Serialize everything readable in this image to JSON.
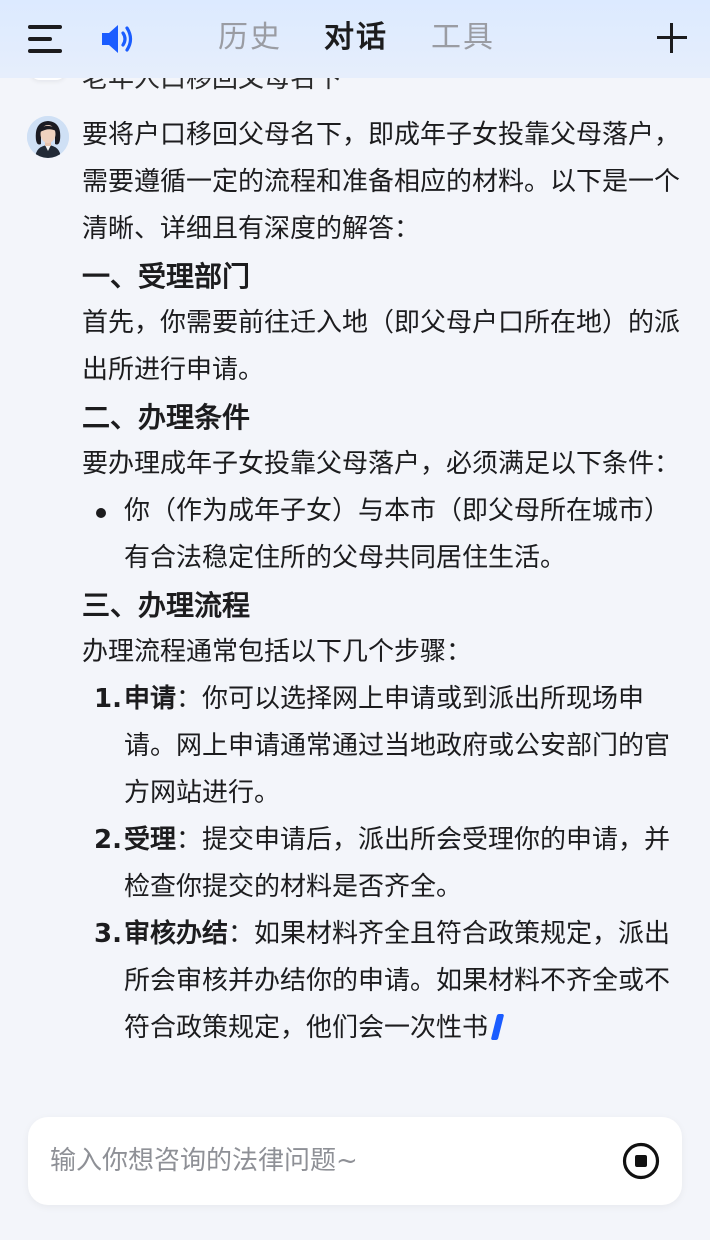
{
  "nav": {
    "tabs": [
      {
        "label": "历史",
        "active": false
      },
      {
        "label": "对话",
        "active": true
      },
      {
        "label": "工具",
        "active": false
      }
    ],
    "icons": [
      "menu-icon",
      "speaker-icon",
      "plus-icon"
    ],
    "accent_color": "#1a5cff"
  },
  "previous_message_cut": "老年人口移回父母名下",
  "answer": {
    "intro": "要将户口移回父母名下，即成年子女投靠父母落户，需要遵循一定的流程和准备相应的材料。以下是一个清晰、详细且有深度的解答：",
    "sections": [
      {
        "heading": "一、受理部门",
        "paragraph": "首先，你需要前往迁入地（即父母户口所在地）的派出所进行申请。"
      },
      {
        "heading": "二、办理条件",
        "paragraph": "要办理成年子女投靠父母落户，必须满足以下条件：",
        "bullets": [
          "你（作为成年子女）与本市（即父母所在城市）有合法稳定住所的父母共同居住生活。"
        ]
      },
      {
        "heading": "三、办理流程",
        "paragraph": "办理流程通常包括以下几个步骤：",
        "steps": [
          {
            "num": "1.",
            "title": "申请",
            "text": "：你可以选择网上申请或到派出所现场申请。网上申请通常通过当地政府或公安部门的官方网站进行。"
          },
          {
            "num": "2.",
            "title": "受理",
            "text": "：提交申请后，派出所会受理你的申请，并检查你提交的材料是否齐全。"
          },
          {
            "num": "3.",
            "title": "审核办结",
            "text": "：如果材料齐全且符合政策规定，派出所会审核并办结你的申请。如果材料不齐全或不符合政策规定，他们会一次性书"
          }
        ]
      }
    ]
  },
  "input": {
    "placeholder": "输入你想咨询的法律问题~"
  }
}
